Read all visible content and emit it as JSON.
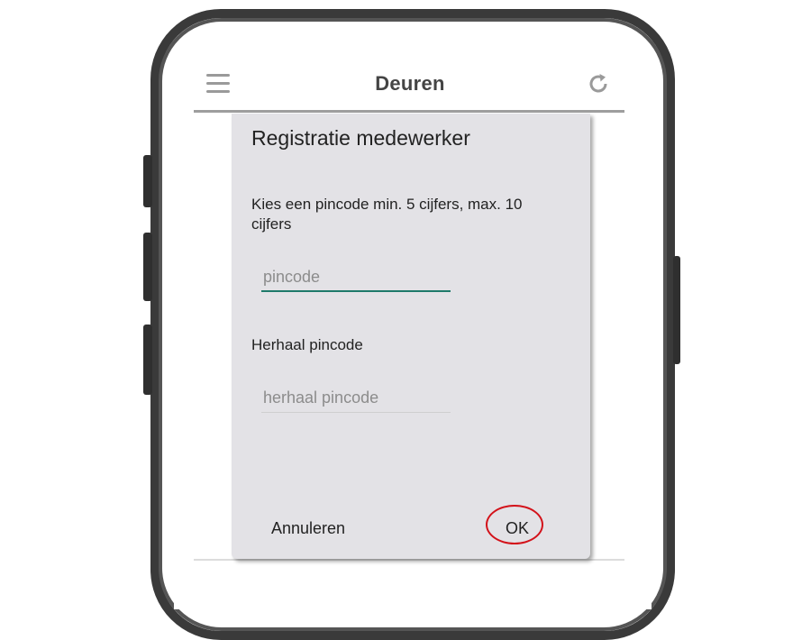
{
  "appbar": {
    "title": "Deuren",
    "left_icon": "menu-icon",
    "right_icon": "refresh-icon"
  },
  "dialog": {
    "title": "Registratie medewerker",
    "instruction": "Kies een pincode min. 5 cijfers, max. 10 cijfers",
    "pincode_field": {
      "placeholder": "pincode",
      "value": ""
    },
    "repeat_label": "Herhaal pincode",
    "repeat_field": {
      "placeholder": "herhaal pincode",
      "value": ""
    },
    "cancel_label": "Annuleren",
    "ok_label": "OK"
  },
  "colors": {
    "accent": "#1f7a6a",
    "highlight": "#d3121a",
    "dialog_bg": "#e3e2e6"
  }
}
